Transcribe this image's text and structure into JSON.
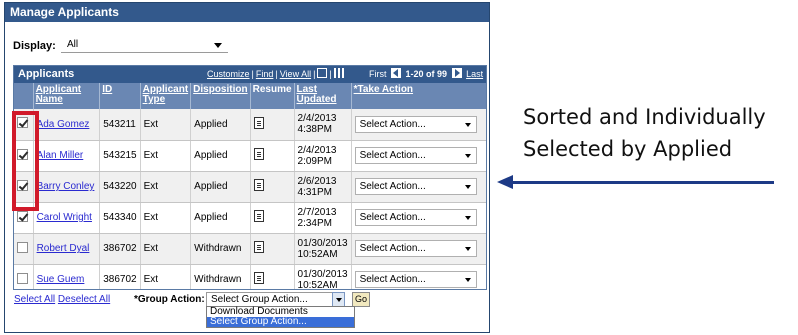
{
  "panel": {
    "title": "Manage Applicants"
  },
  "display": {
    "label": "Display:",
    "value": "All"
  },
  "grid": {
    "title": "Applicants",
    "tools": {
      "customize": "Customize",
      "find": "Find",
      "view_all": "View All"
    },
    "nav": {
      "first": "First",
      "count": "1-20 of 99",
      "last": "Last"
    },
    "columns": {
      "name": "Applicant Name",
      "id": "ID",
      "type": "Applicant Type",
      "disposition": "Disposition",
      "resume": "Resume",
      "last_updated": "Last Updated",
      "take_action": "*Take Action"
    },
    "rows": [
      {
        "checked": true,
        "name": "Ada Gomez",
        "id": "543211",
        "type": "Ext",
        "disposition": "Applied",
        "date": "2/4/2013",
        "time": "4:38PM",
        "action": "Select Action..."
      },
      {
        "checked": true,
        "name": "Alan Miller",
        "id": "543215",
        "type": "Ext",
        "disposition": "Applied",
        "date": "2/4/2013",
        "time": "2:09PM",
        "action": "Select Action..."
      },
      {
        "checked": true,
        "name": "Barry Conley",
        "id": "543220",
        "type": "Ext",
        "disposition": "Applied",
        "date": "2/6/2013",
        "time": "4:31PM",
        "action": "Select Action..."
      },
      {
        "checked": true,
        "name": "Carol Wright",
        "id": "543340",
        "type": "Ext",
        "disposition": "Applied",
        "date": "2/7/2013",
        "time": "2:34PM",
        "action": "Select Action..."
      },
      {
        "checked": false,
        "name": "Robert Dyal",
        "id": "386702",
        "type": "Ext",
        "disposition": "Withdrawn",
        "date": "01/30/2013",
        "time": "10:52AM",
        "action": "Select Action..."
      },
      {
        "checked": false,
        "name": "Sue Guem",
        "id": "386702",
        "type": "Ext",
        "disposition": "Withdrawn",
        "date": "01/30/2013",
        "time": "10:52AM",
        "action": "Select Action..."
      }
    ]
  },
  "footer": {
    "select_all": "Select All",
    "deselect_all": "Deselect All",
    "group_action_label": "*Group Action:",
    "group_action_value": "Select Group Action...",
    "go": "Go",
    "options": [
      "Download Documents",
      "Select Group Action..."
    ]
  },
  "annotation": {
    "line1": "Sorted and Individually",
    "line2": "Selected by Applied"
  },
  "colors": {
    "header": "#33598c",
    "highlight_box": "#d11a2a",
    "arrow": "#1d3a86"
  },
  "icons": {
    "resume": "document-icon",
    "nav_prev": "prev-page-icon",
    "nav_next": "next-page-icon"
  }
}
